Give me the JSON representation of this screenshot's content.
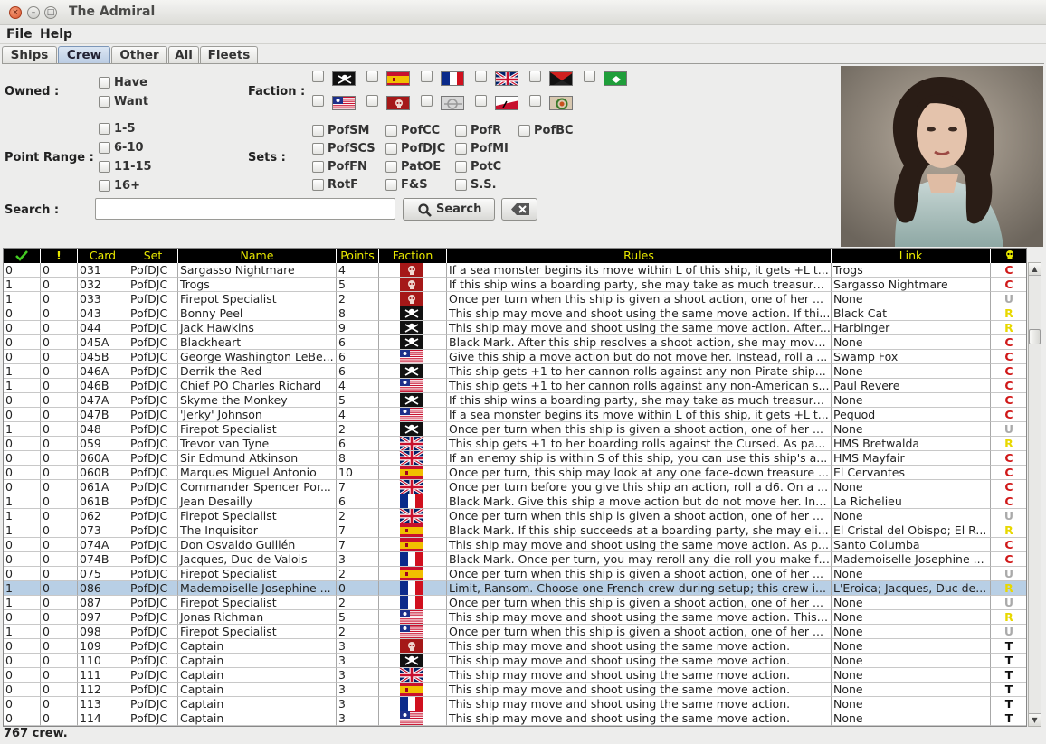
{
  "window": {
    "title": "The Admiral"
  },
  "menu": {
    "file": "File",
    "help": "Help"
  },
  "tabs": [
    "Ships",
    "Crew",
    "Other",
    "All",
    "Fleets"
  ],
  "active_tab": "Crew",
  "filters": {
    "owned_label": "Owned :",
    "have": "Have",
    "want": "Want",
    "faction_label": "Faction :",
    "point_range_label": "Point Range :",
    "point_ranges": [
      "1-5",
      "6-10",
      "11-15",
      "16+"
    ],
    "sets_label": "Sets :",
    "sets": [
      "PofSM",
      "PofCC",
      "PofR",
      "PofBC",
      "PofSCS",
      "PofDJC",
      "PofMI",
      "PofFN",
      "PatOE",
      "PotC",
      "RotF",
      "F&S",
      "S.S."
    ],
    "search_label": "Search :",
    "search_value": "",
    "search_button": "Search"
  },
  "faction_icons": [
    "pirate-flag",
    "spain-flag",
    "france-flag",
    "england-flag",
    "mercenary-flag",
    "barbary-flag",
    "america-flag",
    "cursed-flag",
    "jade-rebellion-flag",
    "vikings-flag",
    "stone-flag"
  ],
  "table": {
    "headers": [
      "✔",
      "!",
      "Card",
      "Set",
      "Name",
      "Points",
      "Faction",
      "Rules",
      "Link",
      "☠"
    ],
    "rows": [
      {
        "have": "0",
        "want": "0",
        "card": "031",
        "set": "PofDJC",
        "name": "Sargasso Nightmare",
        "points": "4",
        "faction": "cursed",
        "rules": "If a sea monster begins its move within L of this ship, it gets +L t...",
        "link": "Trogs",
        "rarity": "C"
      },
      {
        "have": "1",
        "want": "0",
        "card": "032",
        "set": "PofDJC",
        "name": "Trogs",
        "points": "5",
        "faction": "cursed",
        "rules": "If this ship wins a boarding party, she may take as much treasure...",
        "link": "Sargasso Nightmare",
        "rarity": "C"
      },
      {
        "have": "1",
        "want": "0",
        "card": "033",
        "set": "PofDJC",
        "name": "Firepot Specialist",
        "points": "2",
        "faction": "cursed",
        "rules": "Once per turn when this ship is given a shoot action, one of her ...",
        "link": "None",
        "rarity": "U"
      },
      {
        "have": "0",
        "want": "0",
        "card": "043",
        "set": "PofDJC",
        "name": "Bonny Peel",
        "points": "8",
        "faction": "pirate",
        "rules": "This ship may move and shoot using the same move action. If thi...",
        "link": "Black Cat",
        "rarity": "R"
      },
      {
        "have": "0",
        "want": "0",
        "card": "044",
        "set": "PofDJC",
        "name": "Jack Hawkins",
        "points": "9",
        "faction": "pirate",
        "rules": "This ship may move and shoot using the same move action. After...",
        "link": "Harbinger",
        "rarity": "R"
      },
      {
        "have": "0",
        "want": "0",
        "card": "045A",
        "set": "PofDJC",
        "name": "Blackheart",
        "points": "6",
        "faction": "pirate",
        "rules": "Black Mark. After this ship resolves a shoot action, she may move...",
        "link": "None",
        "rarity": "C"
      },
      {
        "have": "0",
        "want": "0",
        "card": "045B",
        "set": "PofDJC",
        "name": "George Washington LeBe...",
        "points": "6",
        "faction": "america",
        "rules": "Give this ship a move action but do not move her. Instead, roll a ...",
        "link": "Swamp Fox",
        "rarity": "C"
      },
      {
        "have": "1",
        "want": "0",
        "card": "046A",
        "set": "PofDJC",
        "name": "Derrik the Red",
        "points": "6",
        "faction": "pirate",
        "rules": "This ship gets +1 to her cannon rolls against any non-Pirate ship...",
        "link": "None",
        "rarity": "C"
      },
      {
        "have": "1",
        "want": "0",
        "card": "046B",
        "set": "PofDJC",
        "name": "Chief PO Charles Richard",
        "points": "4",
        "faction": "america",
        "rules": "This ship gets +1 to her cannon rolls against any non-American s...",
        "link": "Paul Revere",
        "rarity": "C"
      },
      {
        "have": "0",
        "want": "0",
        "card": "047A",
        "set": "PofDJC",
        "name": "Skyme the Monkey",
        "points": "5",
        "faction": "pirate",
        "rules": "If this ship wins a boarding party, she may take as much treasure...",
        "link": "None",
        "rarity": "C"
      },
      {
        "have": "0",
        "want": "0",
        "card": "047B",
        "set": "PofDJC",
        "name": "'Jerky' Johnson",
        "points": "4",
        "faction": "america",
        "rules": "If a sea monster begins its move within L of this ship, it gets +L t...",
        "link": "Pequod",
        "rarity": "C"
      },
      {
        "have": "1",
        "want": "0",
        "card": "048",
        "set": "PofDJC",
        "name": "Firepot Specialist",
        "points": "2",
        "faction": "pirate",
        "rules": "Once per turn when this ship is given a shoot action, one of her ...",
        "link": "None",
        "rarity": "U"
      },
      {
        "have": "0",
        "want": "0",
        "card": "059",
        "set": "PofDJC",
        "name": "Trevor van Tyne",
        "points": "6",
        "faction": "england",
        "rules": "This ship gets +1 to her boarding rolls against the Cursed. As pa...",
        "link": "HMS Bretwalda",
        "rarity": "R"
      },
      {
        "have": "0",
        "want": "0",
        "card": "060A",
        "set": "PofDJC",
        "name": "Sir Edmund Atkinson",
        "points": "8",
        "faction": "england",
        "rules": "If an enemy ship is within S of this ship, you can use this ship's a...",
        "link": "HMS Mayfair",
        "rarity": "C"
      },
      {
        "have": "0",
        "want": "0",
        "card": "060B",
        "set": "PofDJC",
        "name": "Marques Miguel Antonio",
        "points": "10",
        "faction": "spain",
        "rules": "Once per turn, this ship may look at any one face-down treasure ...",
        "link": "El Cervantes",
        "rarity": "C"
      },
      {
        "have": "0",
        "want": "0",
        "card": "061A",
        "set": "PofDJC",
        "name": "Commander Spencer Por...",
        "points": "7",
        "faction": "england",
        "rules": "Once per turn before you give this ship an action, roll a d6. On a ...",
        "link": "None",
        "rarity": "C"
      },
      {
        "have": "1",
        "want": "0",
        "card": "061B",
        "set": "PofDJC",
        "name": "Jean Desailly",
        "points": "6",
        "faction": "france",
        "rules": "Black Mark. Give this ship a move action but do not move her. Ins...",
        "link": "La Richelieu",
        "rarity": "C"
      },
      {
        "have": "1",
        "want": "0",
        "card": "062",
        "set": "PofDJC",
        "name": "Firepot Specialist",
        "points": "2",
        "faction": "england",
        "rules": "Once per turn when this ship is given a shoot action, one of her ...",
        "link": "None",
        "rarity": "U"
      },
      {
        "have": "1",
        "want": "0",
        "card": "073",
        "set": "PofDJC",
        "name": "The Inquisitor",
        "points": "7",
        "faction": "spain",
        "rules": "Black Mark. If this ship succeeds at a boarding party, she may eli...",
        "link": "El Cristal del Obispo; El R...",
        "rarity": "R"
      },
      {
        "have": "0",
        "want": "0",
        "card": "074A",
        "set": "PofDJC",
        "name": "Don Osvaldo Guillén",
        "points": "7",
        "faction": "spain",
        "rules": "This ship may move and shoot using the same move action. As p...",
        "link": "Santo Columba",
        "rarity": "C"
      },
      {
        "have": "0",
        "want": "0",
        "card": "074B",
        "set": "PofDJC",
        "name": "Jacques, Duc de Valois",
        "points": "3",
        "faction": "france",
        "rules": "Black Mark. Once per turn, you may reroll any die roll you make fo...",
        "link": "Mademoiselle Josephine ...",
        "rarity": "C"
      },
      {
        "have": "0",
        "want": "0",
        "card": "075",
        "set": "PofDJC",
        "name": "Firepot Specialist",
        "points": "2",
        "faction": "spain",
        "rules": "Once per turn when this ship is given a shoot action, one of her ...",
        "link": "None",
        "rarity": "U"
      },
      {
        "have": "1",
        "want": "0",
        "card": "086",
        "set": "PofDJC",
        "name": "Mademoiselle Josephine ...",
        "points": "0",
        "faction": "france",
        "rules": "Limit, Ransom. Choose one French crew during setup; this crew i...",
        "link": "L'Eroica; Jacques, Duc de...",
        "rarity": "R",
        "selected": true
      },
      {
        "have": "1",
        "want": "0",
        "card": "087",
        "set": "PofDJC",
        "name": "Firepot Specialist",
        "points": "2",
        "faction": "france",
        "rules": "Once per turn when this ship is given a shoot action, one of her ...",
        "link": "None",
        "rarity": "U"
      },
      {
        "have": "0",
        "want": "0",
        "card": "097",
        "set": "PofDJC",
        "name": "Jonas Richman",
        "points": "5",
        "faction": "america",
        "rules": "This ship may move and shoot using the same move action. This ...",
        "link": "None",
        "rarity": "R"
      },
      {
        "have": "1",
        "want": "0",
        "card": "098",
        "set": "PofDJC",
        "name": "Firepot Specialist",
        "points": "2",
        "faction": "america",
        "rules": "Once per turn when this ship is given a shoot action, one of her ...",
        "link": "None",
        "rarity": "U"
      },
      {
        "have": "0",
        "want": "0",
        "card": "109",
        "set": "PofDJC",
        "name": "Captain",
        "points": "3",
        "faction": "cursed",
        "rules": "This ship may move and shoot using the same move action.",
        "link": "None",
        "rarity": "T"
      },
      {
        "have": "0",
        "want": "0",
        "card": "110",
        "set": "PofDJC",
        "name": "Captain",
        "points": "3",
        "faction": "pirate",
        "rules": "This ship may move and shoot using the same move action.",
        "link": "None",
        "rarity": "T"
      },
      {
        "have": "0",
        "want": "0",
        "card": "111",
        "set": "PofDJC",
        "name": "Captain",
        "points": "3",
        "faction": "england",
        "rules": "This ship may move and shoot using the same move action.",
        "link": "None",
        "rarity": "T"
      },
      {
        "have": "0",
        "want": "0",
        "card": "112",
        "set": "PofDJC",
        "name": "Captain",
        "points": "3",
        "faction": "spain",
        "rules": "This ship may move and shoot using the same move action.",
        "link": "None",
        "rarity": "T"
      },
      {
        "have": "0",
        "want": "0",
        "card": "113",
        "set": "PofDJC",
        "name": "Captain",
        "points": "3",
        "faction": "france",
        "rules": "This ship may move and shoot using the same move action.",
        "link": "None",
        "rarity": "T"
      },
      {
        "have": "0",
        "want": "0",
        "card": "114",
        "set": "PofDJC",
        "name": "Captain",
        "points": "3",
        "faction": "america",
        "rules": "This ship may move and shoot using the same move action.",
        "link": "None",
        "rarity": "T"
      }
    ]
  },
  "rarity_colors": {
    "C": "#d01818",
    "U": "#aaaaaa",
    "R": "#e8d800",
    "T": "#111111"
  },
  "status": "767 crew."
}
